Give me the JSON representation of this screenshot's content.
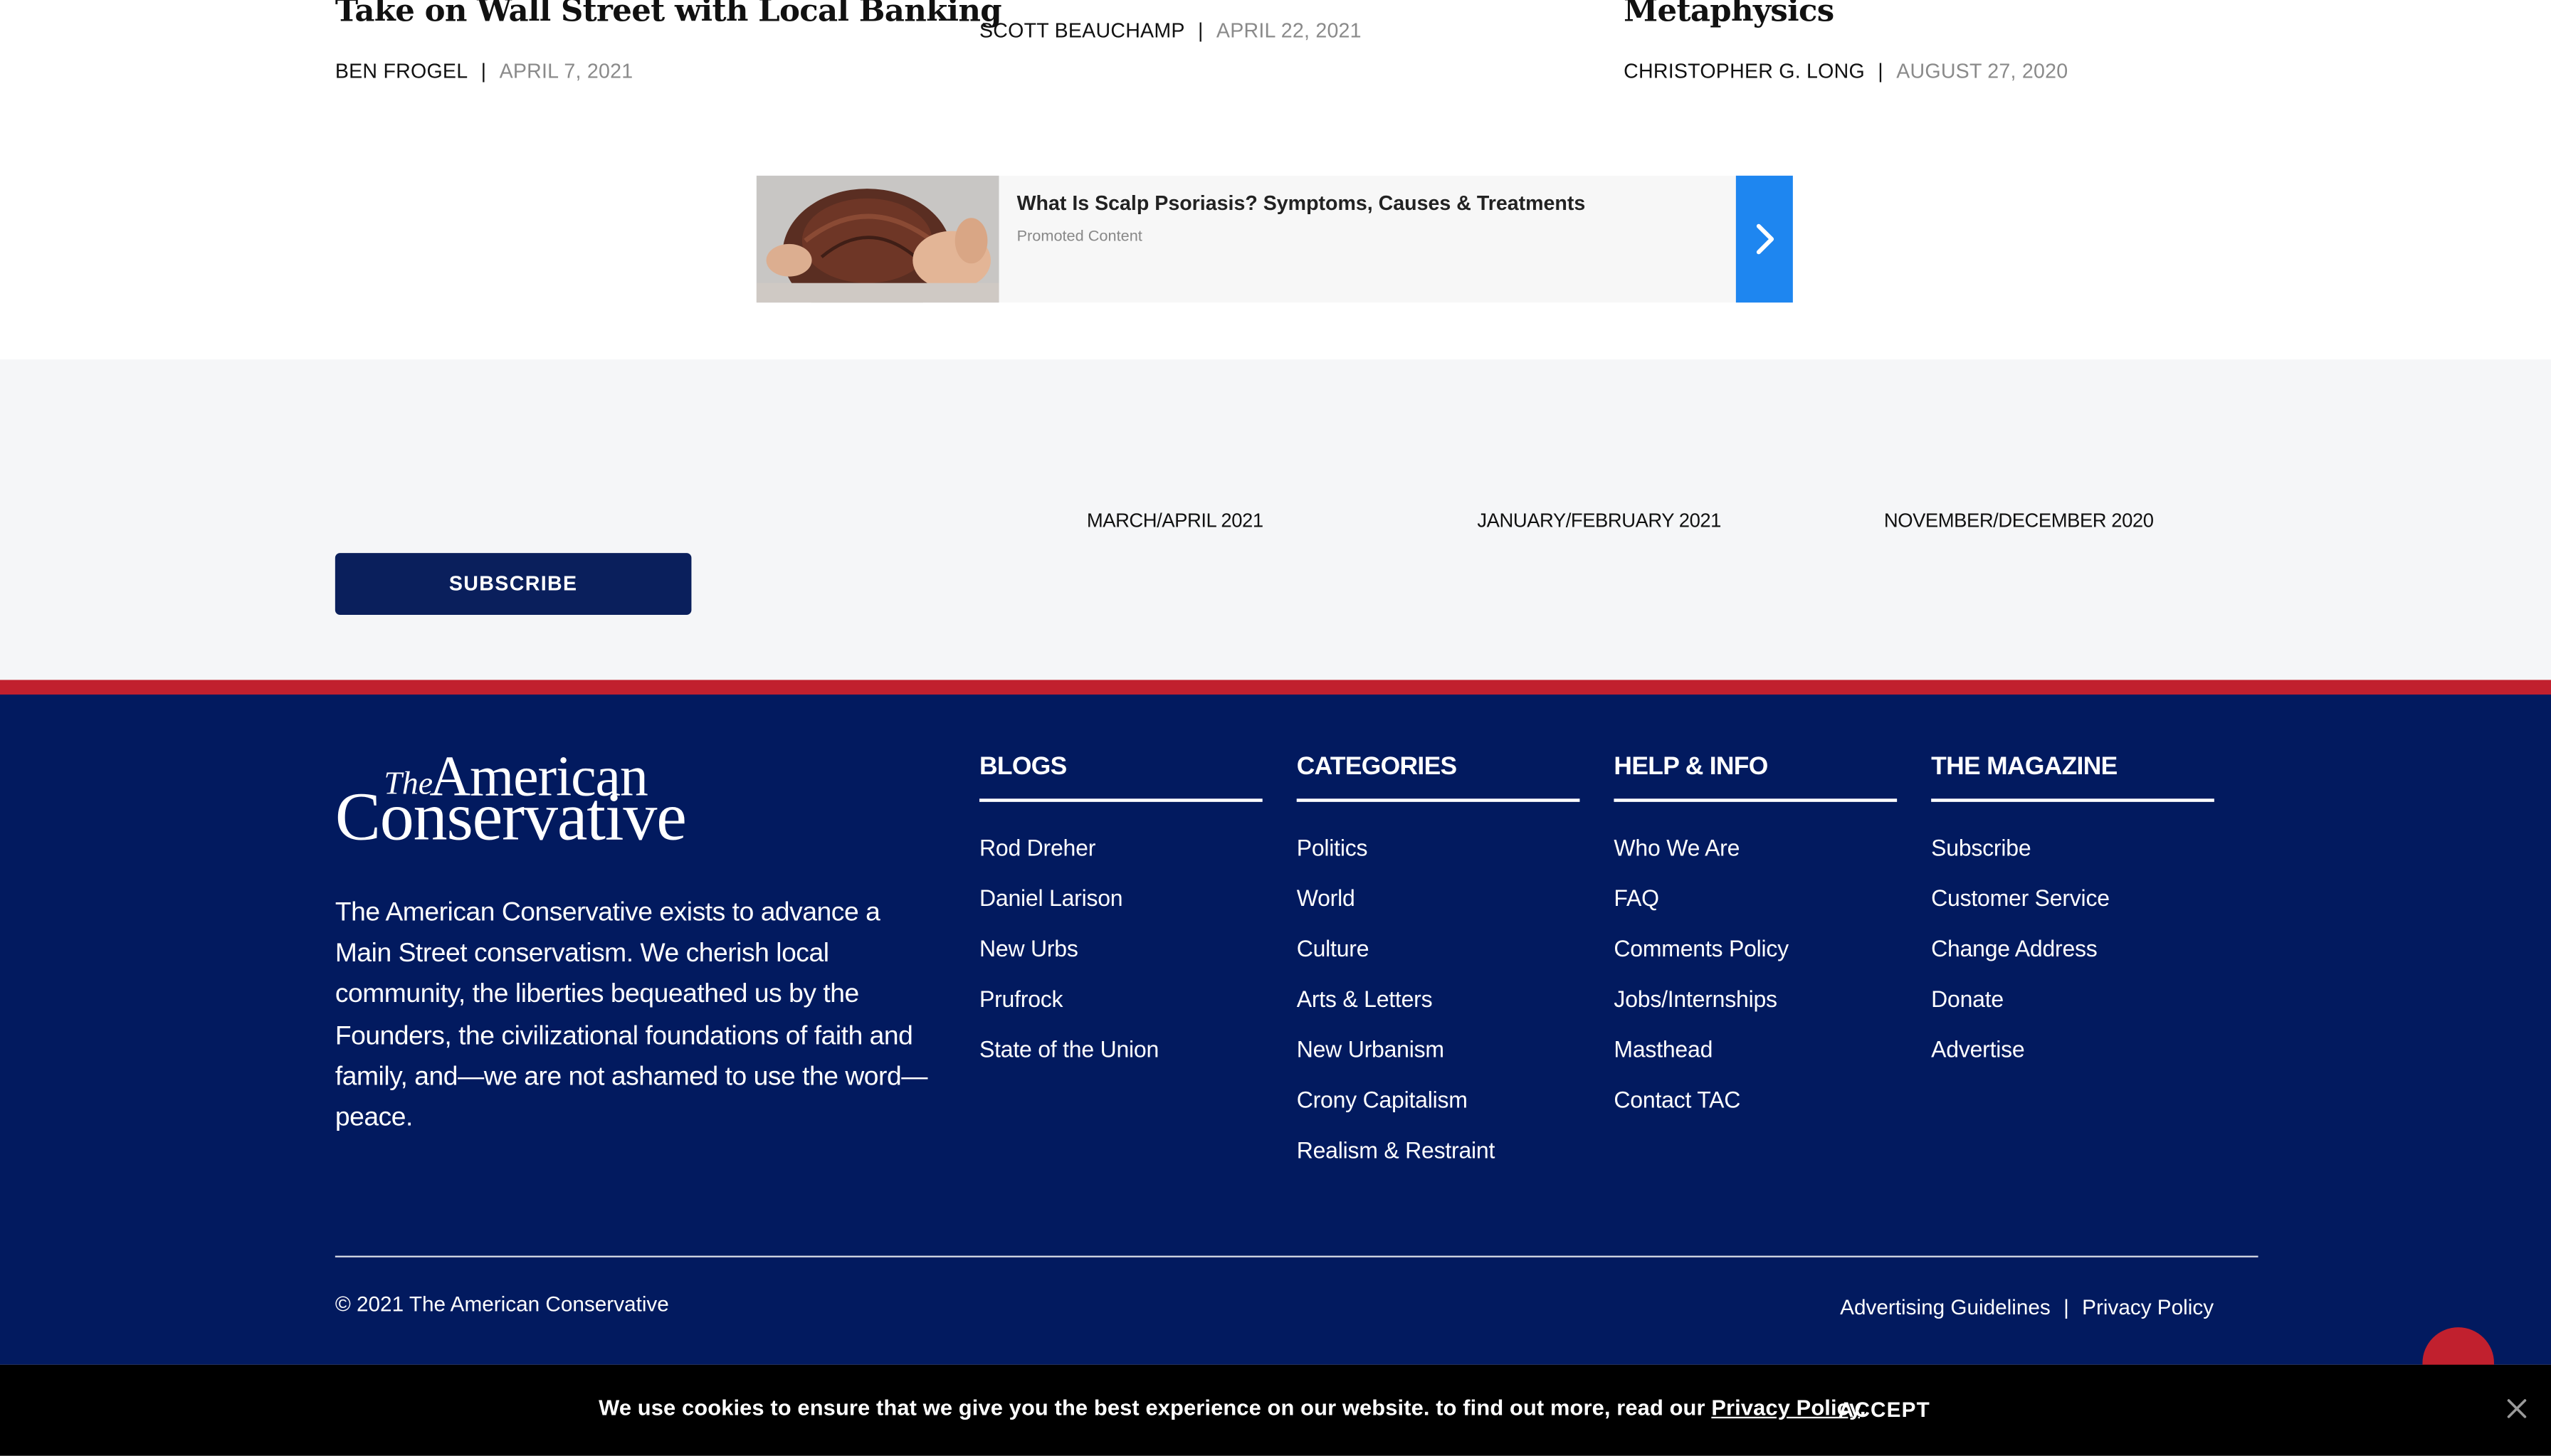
{
  "articles": [
    {
      "title": "Take on Wall Street with Local Banking",
      "author": "BEN FROGEL",
      "date": "APRIL 7, 2021"
    },
    {
      "title": "",
      "author": "SCOTT BEAUCHAMP",
      "date": "APRIL 22, 2021"
    },
    {
      "title": "Metaphysics",
      "author": "CHRISTOPHER G. LONG",
      "date": "AUGUST 27, 2020"
    }
  ],
  "promo": {
    "title": "What Is Scalp Psoriasis? Symptoms, Causes & Treatments",
    "sub": "Promoted Content",
    "arrow_icon": "chevron-right-icon"
  },
  "magazine": {
    "issues": [
      "MARCH/APRIL 2021",
      "JANUARY/FEBRUARY 2021",
      "NOVEMBER/DECEMBER 2020"
    ],
    "subscribe_label": "SUBSCRIBE"
  },
  "footer": {
    "logo": {
      "the": "The",
      "american": "American",
      "conservative": "Conservative"
    },
    "mission": "The American Conservative exists to advance a Main Street conservatism. We cherish local community, the liberties bequeathed us by the Founders, the civilizational foundations of faith and family, and—we are not ashamed to use the word—peace.",
    "columns": [
      {
        "heading": "BLOGS",
        "links": [
          "Rod Dreher",
          "Daniel Larison",
          "New Urbs",
          "Prufrock",
          "State of the Union"
        ]
      },
      {
        "heading": "CATEGORIES",
        "links": [
          "Politics",
          "World",
          "Culture",
          "Arts & Letters",
          "New Urbanism",
          "Crony Capitalism",
          "Realism & Restraint"
        ]
      },
      {
        "heading": "HELP & INFO",
        "links": [
          "Who We Are",
          "FAQ",
          "Comments Policy",
          "Jobs/Internships",
          "Masthead",
          "Contact TAC"
        ]
      },
      {
        "heading": "THE MAGAZINE",
        "links": [
          "Subscribe",
          "Customer Service",
          "Change Address",
          "Donate",
          "Advertise"
        ]
      }
    ],
    "copyright": "© 2021 The American Conservative",
    "legal": {
      "advertising": "Advertising Guidelines",
      "privacy": "Privacy Policy",
      "separator": "|"
    }
  },
  "cookie": {
    "text": "We use cookies to ensure that we give you the best experience on our website. to find out more, read our ",
    "link": "Privacy Policy",
    "after": ".",
    "accept": "ACCEPT",
    "close_icon": "close-icon"
  },
  "colors": {
    "navy": "#021a5f",
    "red": "#c1202e",
    "button": "#0a1f5c",
    "promo_blue": "#1e86f0"
  }
}
